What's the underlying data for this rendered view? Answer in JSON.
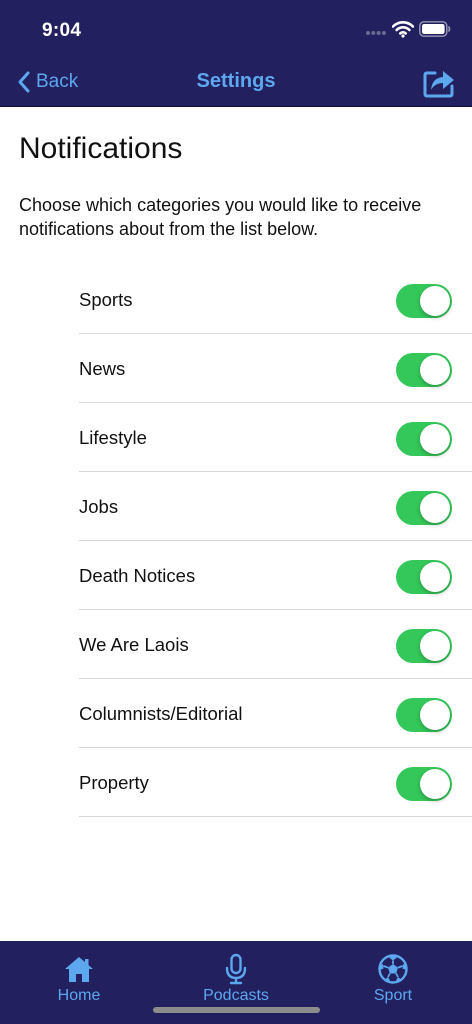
{
  "status_bar": {
    "time": "9:04"
  },
  "nav": {
    "back_label": "Back",
    "title": "Settings",
    "share_icon": "share-icon"
  },
  "content": {
    "title": "Notifications",
    "description": "Choose which categories you would like to receive notifications about from the list below."
  },
  "categories": [
    {
      "label": "Sports",
      "enabled": true
    },
    {
      "label": "News",
      "enabled": true
    },
    {
      "label": "Lifestyle",
      "enabled": true
    },
    {
      "label": "Jobs",
      "enabled": true
    },
    {
      "label": "Death Notices",
      "enabled": true
    },
    {
      "label": "We Are Laois",
      "enabled": true
    },
    {
      "label": "Columnists/Editorial",
      "enabled": true
    },
    {
      "label": "Property",
      "enabled": true
    }
  ],
  "tabs": [
    {
      "label": "Home",
      "icon": "home-icon"
    },
    {
      "label": "Podcasts",
      "icon": "microphone-icon"
    },
    {
      "label": "Sport",
      "icon": "football-icon"
    }
  ],
  "colors": {
    "bar_background": "#22205f",
    "accent": "#5da7ef",
    "toggle_on": "#34c759"
  }
}
